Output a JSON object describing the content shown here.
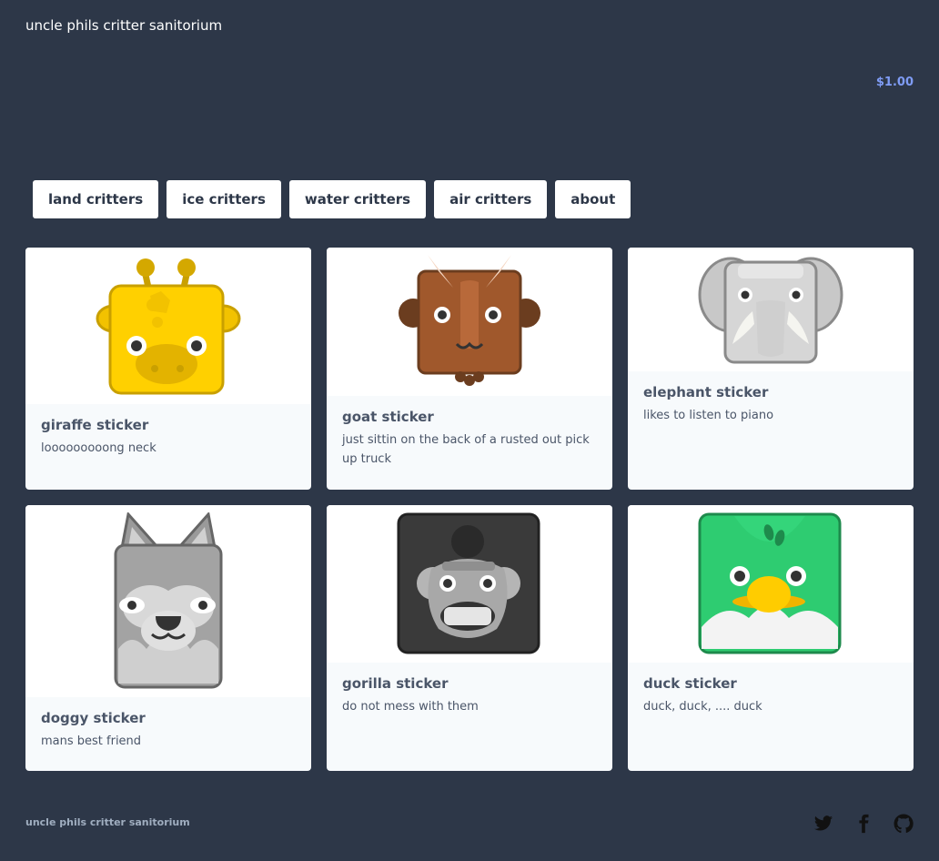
{
  "header": {
    "site_title": "uncle phils critter sanitorium",
    "cart_total": "$1.00"
  },
  "nav": [
    {
      "label": "land critters"
    },
    {
      "label": "ice critters"
    },
    {
      "label": "water critters"
    },
    {
      "label": "air critters"
    },
    {
      "label": "about"
    }
  ],
  "products": [
    {
      "title": "giraffe sticker",
      "desc": "looooooooong neck",
      "icon": "giraffe-sticker-image"
    },
    {
      "title": "goat sticker",
      "desc": "just sittin on the back of a rusted out pick up truck",
      "icon": "goat-sticker-image"
    },
    {
      "title": "elephant sticker",
      "desc": "likes to listen to piano",
      "icon": "elephant-sticker-image"
    },
    {
      "title": "doggy sticker",
      "desc": "mans best friend",
      "icon": "doggy-sticker-image"
    },
    {
      "title": "gorilla sticker",
      "desc": "do not mess with them",
      "icon": "gorilla-sticker-image"
    },
    {
      "title": "duck sticker",
      "desc": "duck, duck, .... duck",
      "icon": "duck-sticker-image"
    }
  ],
  "footer": {
    "site_title": "uncle phils critter sanitorium",
    "social": [
      "twitter-icon",
      "facebook-icon",
      "github-icon"
    ]
  }
}
